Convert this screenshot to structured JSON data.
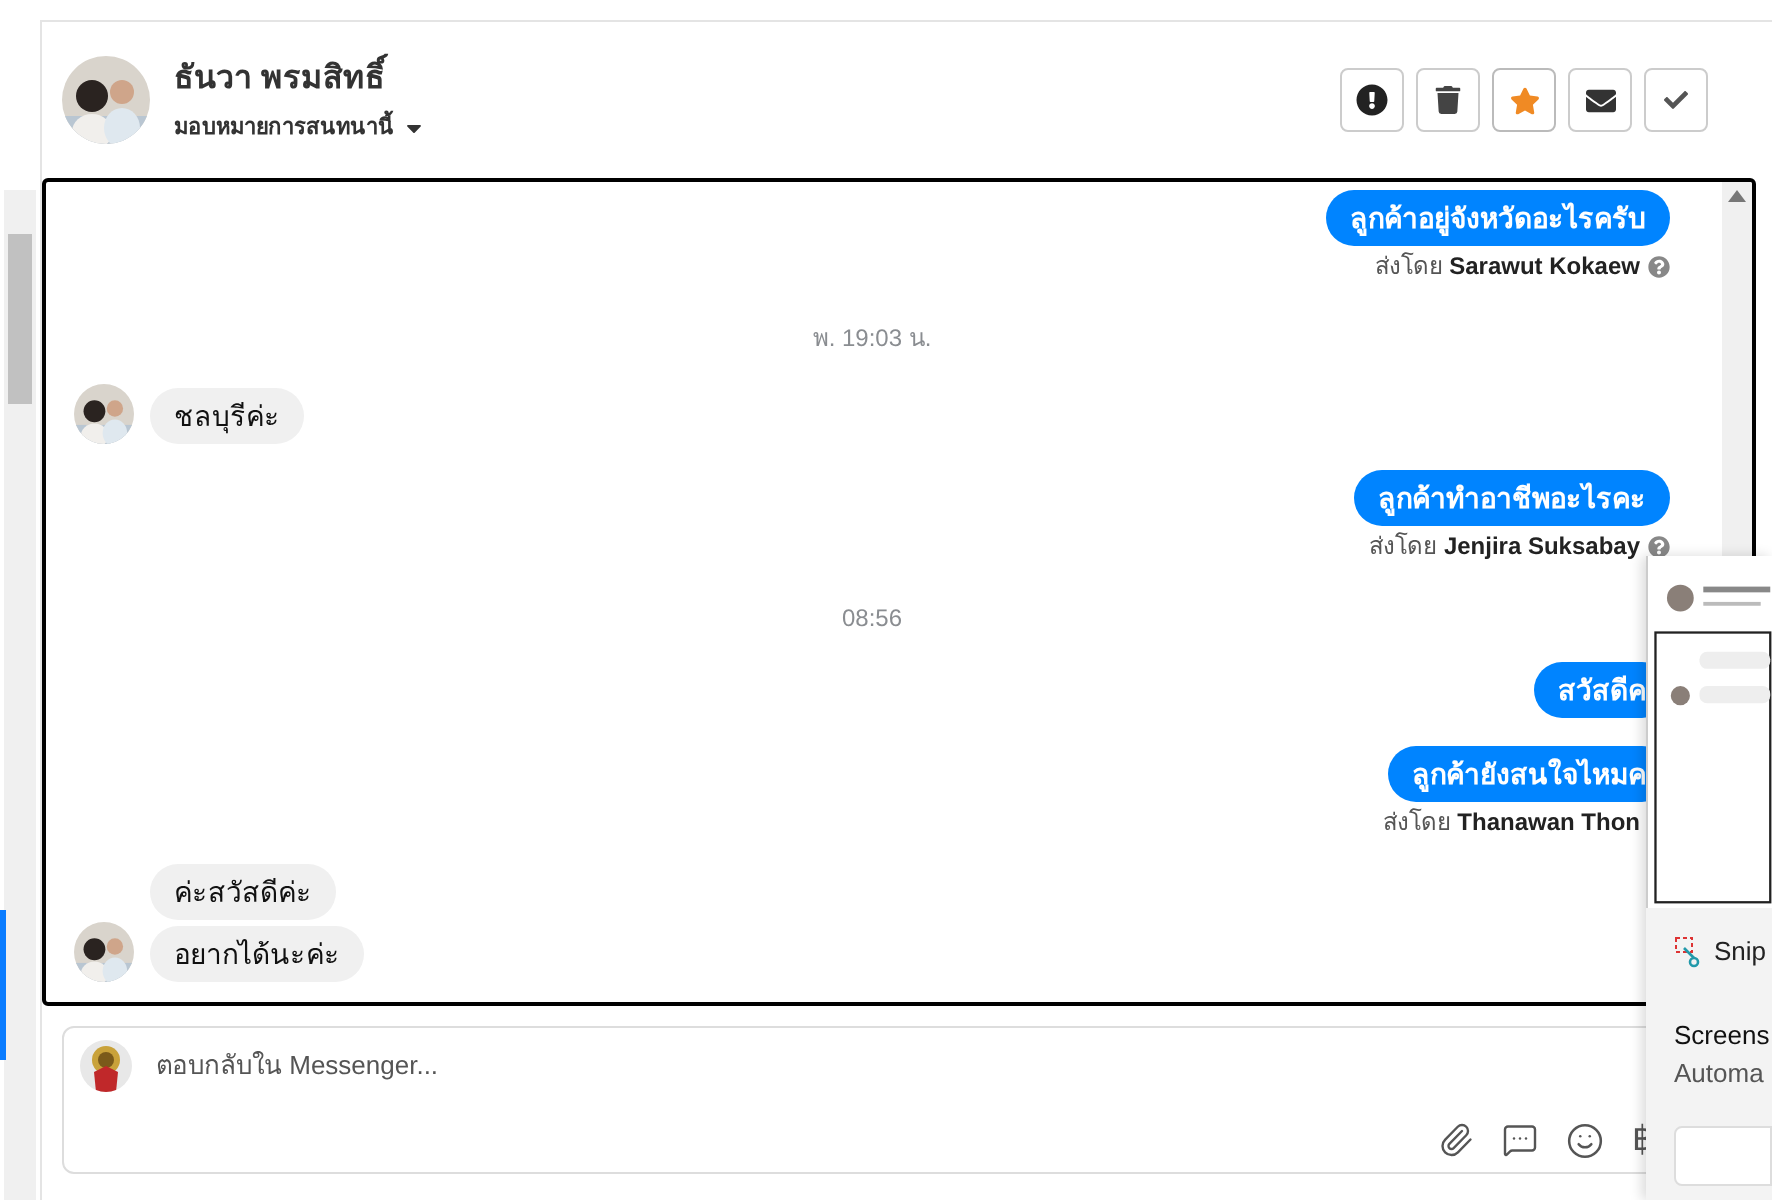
{
  "header": {
    "name": "ธันวา พรมสิทธิ์",
    "assign_label": "มอบหมายการสนทนานี้",
    "actions": [
      {
        "kind": "alert",
        "active": false
      },
      {
        "kind": "delete",
        "active": false
      },
      {
        "kind": "star",
        "active": true
      },
      {
        "kind": "mail",
        "active": false
      },
      {
        "kind": "done",
        "active": false
      }
    ]
  },
  "messages": [
    {
      "kind": "out",
      "text": "ลูกค้าอยู่จังหวัดอะไรครับ",
      "sender_prefix": "ส่งโดย",
      "sender": "Sarawut Kokaew",
      "help_icon": true
    },
    {
      "kind": "time",
      "text": "พ. 19:03 น."
    },
    {
      "kind": "in",
      "texts": [
        "ชลบุรีค่ะ"
      ]
    },
    {
      "kind": "out",
      "text": "ลูกค้าทำอาชีพอะไรคะ",
      "sender_prefix": "ส่งโดย",
      "sender": "Jenjira Suksabay",
      "help_icon": true
    },
    {
      "kind": "time",
      "text": "08:56"
    },
    {
      "kind": "out",
      "text": "สวัสดีค"
    },
    {
      "kind": "out",
      "text": "ลูกค้ายังสนใจไหมค",
      "sender_prefix": "ส่งโดย",
      "sender": "Thanawan Thon",
      "help_icon": false
    },
    {
      "kind": "in",
      "texts": [
        "ค่ะสวัสดีค่ะ",
        "อยากได้นะค่ะ"
      ]
    }
  ],
  "composer": {
    "placeholder": "ตอบกลับใน Messenger...",
    "tools": [
      {
        "kind": "attach"
      },
      {
        "kind": "reply"
      },
      {
        "kind": "emoji"
      },
      {
        "kind": "currency",
        "text": "฿"
      }
    ]
  },
  "snip_notification": {
    "app": "Snip",
    "title": "Screens",
    "body": "Automa"
  }
}
